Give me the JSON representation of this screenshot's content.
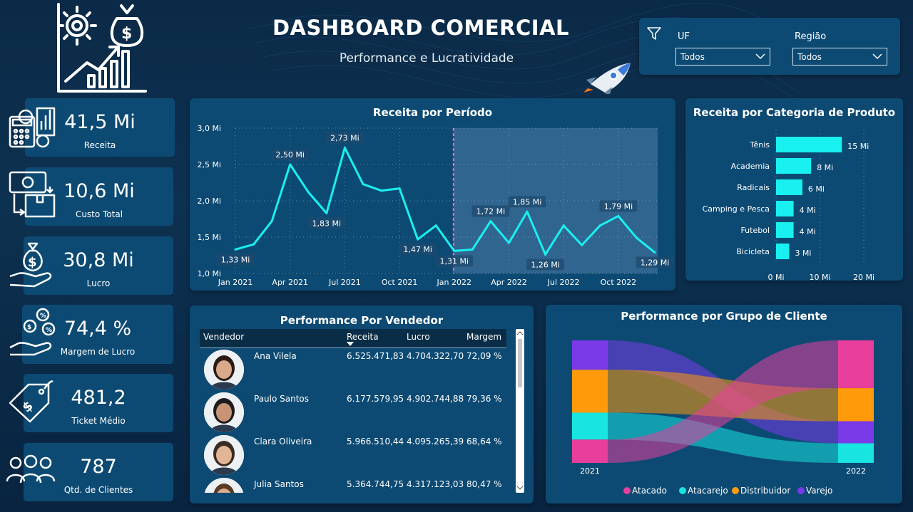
{
  "header": {
    "title": "DASHBOARD COMERCIAL",
    "subtitle": "Performance e Lucratividade"
  },
  "filters": {
    "uf_label": "UF",
    "uf_value": "Todos",
    "regiao_label": "Região",
    "regiao_value": "Todos"
  },
  "kpis": [
    {
      "value": "41,5 Mi",
      "label": "Receita",
      "icon": "revenue-calculator-icon"
    },
    {
      "value": "10,6 Mi",
      "label": "Custo Total",
      "icon": "cost-box-icon"
    },
    {
      "value": "30,8 Mi",
      "label": "Lucro",
      "icon": "money-bag-hand-icon"
    },
    {
      "value": "74,4 %",
      "label": "Margem de Lucro",
      "icon": "percent-hand-icon"
    },
    {
      "value": "481,2",
      "label": "Ticket Médio",
      "icon": "price-tag-icon"
    },
    {
      "value": "787",
      "label": "Qtd. de Clientes",
      "icon": "people-group-icon"
    }
  ],
  "colors": {
    "accent": "#19f0f0",
    "panel": "#0d4a73",
    "background": "#0b2a48",
    "atacado": "#e83e9c",
    "atacarejo": "#18e4e0",
    "distribuidor": "#ff9a0a",
    "varejo": "#7a3ae8"
  },
  "chart_data": [
    {
      "type": "line",
      "title": "Receita por Período",
      "y_ticks": [
        "3,0 Mi",
        "2,5 Mi",
        "2,0 Mi",
        "1,5 Mi",
        "1,0 Mi"
      ],
      "ylim": [
        1.0,
        3.0
      ],
      "x_ticks": [
        "Jan 2021",
        "Apr 2021",
        "Jul 2021",
        "Oct 2021",
        "Jan 2022",
        "Apr 2022",
        "Jul 2022",
        "Oct 2022"
      ],
      "x": [
        "Jan 2021",
        "Feb 2021",
        "Mar 2021",
        "Apr 2021",
        "May 2021",
        "Jun 2021",
        "Jul 2021",
        "Aug 2021",
        "Sep 2021",
        "Oct 2021",
        "Nov 2021",
        "Dec 2021",
        "Jan 2022",
        "Feb 2022",
        "Mar 2022",
        "Apr 2022",
        "May 2022",
        "Jun 2022",
        "Jul 2022",
        "Aug 2022",
        "Sep 2022",
        "Oct 2022",
        "Nov 2022",
        "Dec 2022"
      ],
      "values": [
        1.33,
        1.4,
        1.72,
        2.5,
        2.12,
        1.83,
        2.73,
        2.23,
        2.14,
        2.17,
        1.47,
        1.66,
        1.31,
        1.33,
        1.72,
        1.42,
        1.85,
        1.26,
        1.66,
        1.39,
        1.66,
        1.79,
        1.49,
        1.29
      ],
      "data_labels": [
        {
          "index": 0,
          "text": "1,33 Mi"
        },
        {
          "index": 3,
          "text": "2,50 Mi"
        },
        {
          "index": 5,
          "text": "1,83 Mi"
        },
        {
          "index": 6,
          "text": "2,73 Mi"
        },
        {
          "index": 10,
          "text": "1,47 Mi"
        },
        {
          "index": 12,
          "text": "1,31 Mi"
        },
        {
          "index": 14,
          "text": "1,72 Mi"
        },
        {
          "index": 16,
          "text": "1,85 Mi"
        },
        {
          "index": 17,
          "text": "1,26 Mi"
        },
        {
          "index": 21,
          "text": "1,79 Mi"
        },
        {
          "index": 23,
          "text": "1,29 Mi"
        }
      ],
      "highlight_range": [
        "Jan 2022",
        "Dec 2022"
      ],
      "grid": true
    },
    {
      "type": "bar",
      "orientation": "horizontal",
      "title": "Receita por Categoria de Produto",
      "categories": [
        "Tênis",
        "Academia",
        "Radicais",
        "Camping e Pesca",
        "Futebol",
        "Bicicleta"
      ],
      "values": [
        15,
        8,
        6,
        4,
        4,
        3
      ],
      "value_labels": [
        "15 Mi",
        "8 Mi",
        "6 Mi",
        "4 Mi",
        "4 Mi",
        "3 Mi"
      ],
      "x_ticks": [
        "0 Mi",
        "10 Mi",
        "20 Mi"
      ],
      "xlim": [
        0,
        20
      ],
      "grid": true
    },
    {
      "type": "sankey",
      "title": "Performance por Grupo de Cliente",
      "nodes_left_label": "2021",
      "nodes_right_label": "2022",
      "left_order": [
        "Varejo",
        "Distribuidor",
        "Atacarejo",
        "Atacado"
      ],
      "right_order": [
        "Atacado",
        "Distribuidor",
        "Varejo",
        "Atacarejo"
      ],
      "left_shares": [
        0.24,
        0.35,
        0.22,
        0.19
      ],
      "right_shares": [
        0.39,
        0.27,
        0.18,
        0.16
      ],
      "legend": [
        "Atacado",
        "Atacarejo",
        "Distribuidor",
        "Varejo"
      ],
      "legend_position": "bottom"
    }
  ],
  "vendedores": {
    "title": "Performance Por Vendedor",
    "columns": [
      "Vendedor",
      "Receita",
      "Lucro",
      "Margem"
    ],
    "rows": [
      {
        "name": "Ana Vilela",
        "receita": "6.525.471,83",
        "lucro": "4.704.322,70",
        "margem": "72,09 %"
      },
      {
        "name": "Paulo Santos",
        "receita": "6.177.579,95",
        "lucro": "4.902.744,88",
        "margem": "79,36 %"
      },
      {
        "name": "Clara Oliveira",
        "receita": "5.966.510,44",
        "lucro": "4.095.265,39",
        "margem": "68,64 %"
      },
      {
        "name": "Julia Santos",
        "receita": "5.364.744,75",
        "lucro": "4.317.123,03",
        "margem": "80,47 %"
      }
    ]
  }
}
